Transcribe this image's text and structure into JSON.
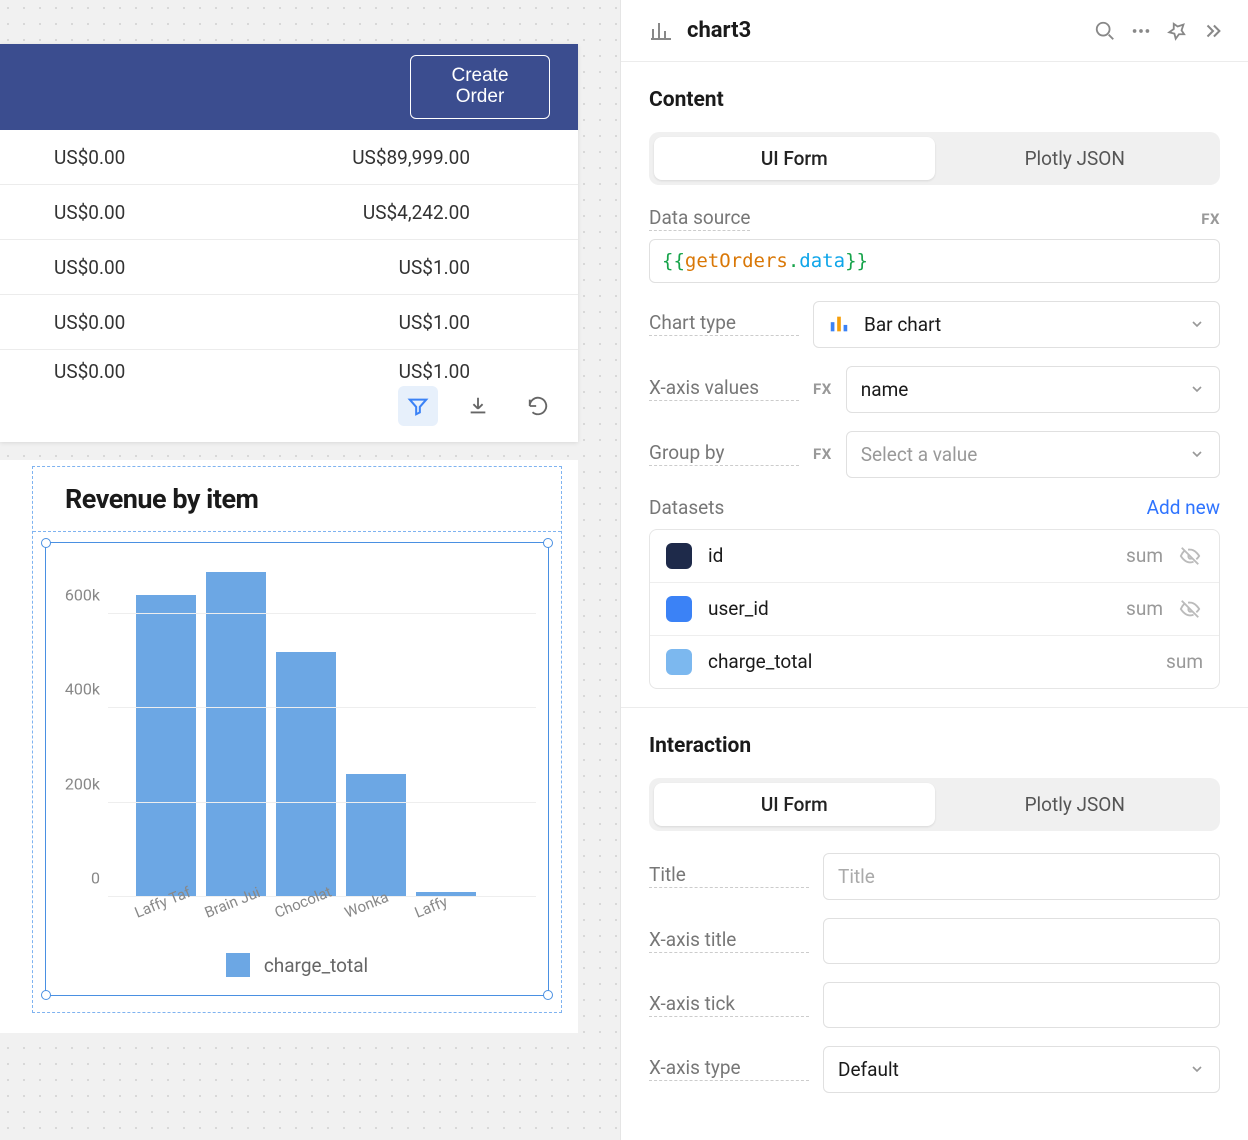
{
  "header": {
    "create_order": "Create Order"
  },
  "table": {
    "rows": [
      {
        "a": "US$0.00",
        "b": "US$89,999.00"
      },
      {
        "a": "US$0.00",
        "b": "US$4,242.00"
      },
      {
        "a": "US$0.00",
        "b": "US$1.00"
      },
      {
        "a": "US$0.00",
        "b": "US$1.00"
      },
      {
        "a": "US$0.00",
        "b": "US$1.00"
      }
    ]
  },
  "chart": {
    "title": "Revenue by item",
    "legend": "charge_total"
  },
  "chart_data": {
    "type": "bar",
    "title": "Revenue by item",
    "categories": [
      "Laffy Taf",
      "Brain Jui",
      "Chocolat",
      "Wonka",
      "Laffy"
    ],
    "series": [
      {
        "name": "charge_total",
        "values": [
          640000,
          690000,
          520000,
          260000,
          10000
        ]
      }
    ],
    "ylabel": "",
    "xlabel": "",
    "ylim": [
      0,
      700000
    ],
    "yticks": [
      0,
      200000,
      400000,
      600000
    ],
    "ytick_labels": [
      "0",
      "200k",
      "400k",
      "600k"
    ]
  },
  "inspector": {
    "name": "chart3",
    "content": {
      "section_title": "Content",
      "tab_ui": "UI Form",
      "tab_json": "Plotly JSON",
      "data_source_label": "Data source",
      "data_source_value": "{{getOrders.data}}",
      "chart_type_label": "Chart type",
      "chart_type_value": "Bar chart",
      "x_axis_label": "X-axis values",
      "x_axis_value": "name",
      "group_by_label": "Group by",
      "group_by_placeholder": "Select a value",
      "datasets_label": "Datasets",
      "add_new": "Add new",
      "fx": "FX",
      "datasets": [
        {
          "name": "id",
          "agg": "sum",
          "color": "#1e2a4a",
          "hidden": true
        },
        {
          "name": "user_id",
          "agg": "sum",
          "color": "#3b82f6",
          "hidden": true
        },
        {
          "name": "charge_total",
          "agg": "sum",
          "color": "#7cb8ef",
          "hidden": false
        }
      ]
    },
    "interaction": {
      "section_title": "Interaction",
      "tab_ui": "UI Form",
      "tab_json": "Plotly JSON",
      "title_label": "Title",
      "title_placeholder": "Title",
      "x_title_label": "X-axis title",
      "x_tick_label": "X-axis tick",
      "x_type_label": "X-axis type",
      "x_type_value": "Default"
    }
  }
}
